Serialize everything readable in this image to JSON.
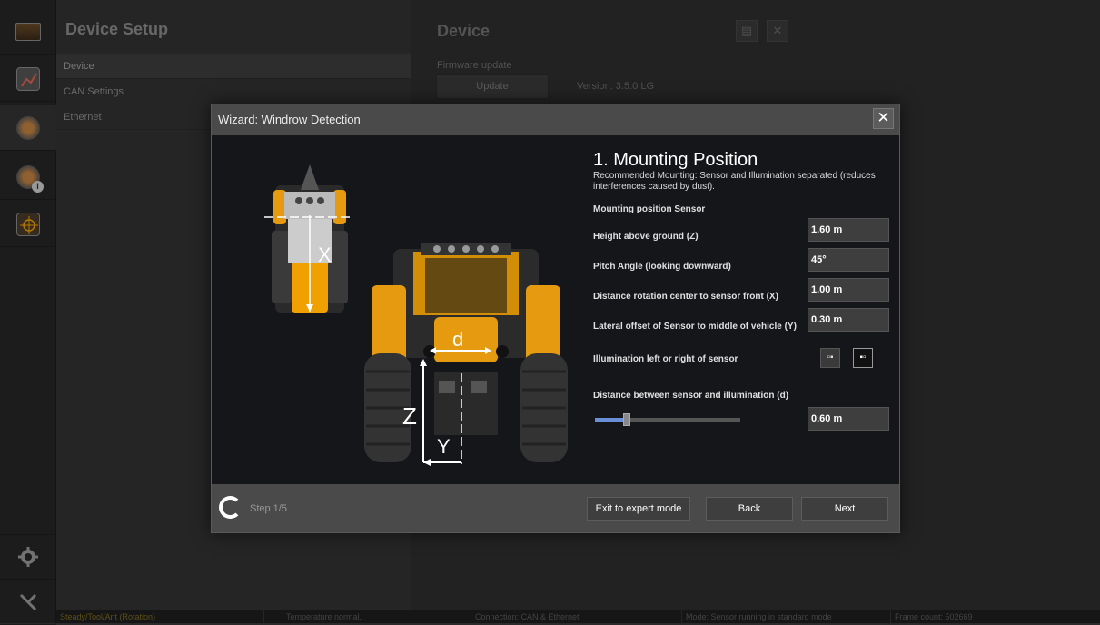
{
  "setup": {
    "title": "Device Setup",
    "items": [
      "Device",
      "CAN Settings",
      "Ethernet"
    ]
  },
  "device": {
    "title": "Device",
    "fw_label": "Firmware update",
    "update_label": "Update",
    "version": "Version: 3.5.0 LG"
  },
  "status": {
    "state": "Steady/Tool/Ant (Rotation)",
    "temperature": "Temperature normal.",
    "connection": "Connection: CAN & Ethernet",
    "mode": "Mode: Sensor running in standard mode",
    "frames": "Frame count: 502669"
  },
  "wizard": {
    "title": "Wizard: Windrow Detection",
    "close": "✕",
    "heading": "1. Mounting Position",
    "recommendation": "Recommended Mounting: Sensor and Illumination separated (reduces interferences caused by dust).",
    "subheading": "Mounting position Sensor",
    "fields": {
      "height_label": "Height above ground (Z)",
      "height_value": "1.60 m",
      "pitch_label": "Pitch Angle (looking downward)",
      "pitch_value": "45°",
      "distance_label": "Distance rotation center to sensor front (X)",
      "distance_value": "1.00 m",
      "lateral_label": "Lateral offset of Sensor to middle of vehicle (Y)",
      "lateral_value": "0.30 m",
      "illum_label": "Illumination left or right of sensor",
      "separation_label": "Distance between sensor and illumination (d)",
      "separation_value": "0.60 m"
    },
    "slider_fraction": 0.22,
    "illum_selected": "right",
    "diagram_labels": {
      "x": "X",
      "d": "d",
      "z": "Z",
      "y": "Y"
    },
    "step": "Step 1/5",
    "buttons": {
      "expert": "Exit to expert mode",
      "back": "Back",
      "next": "Next"
    }
  },
  "colors": {
    "accent": "#f0a000",
    "slider": "#6b8fd6",
    "dialog": "#4a4a4a",
    "body": "#141619"
  },
  "icons": [
    "monitor-icon",
    "chart-icon",
    "camera-icon",
    "camera-info-icon",
    "target-icon",
    "gear-icon",
    "tools-icon",
    "save-icon",
    "close-icon"
  ]
}
